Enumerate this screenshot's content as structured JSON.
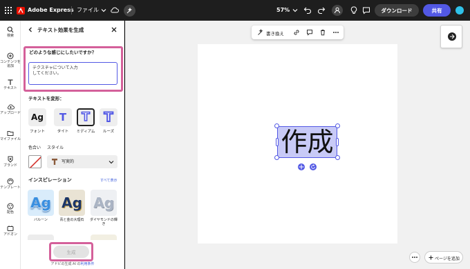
{
  "app": {
    "name": "Adobe Express",
    "file_menu": "ファイル",
    "zoom": "57%",
    "download_label": "ダウンロード",
    "share_label": "共有"
  },
  "rail": [
    {
      "label": "検索",
      "icon": "search-icon"
    },
    {
      "label": "コンテンツを追加",
      "icon": "plus-circle-icon"
    },
    {
      "label": "テキスト",
      "icon": "text-icon"
    },
    {
      "label": "アップロード",
      "icon": "upload-icon"
    },
    {
      "label": "マイファイル",
      "icon": "folder-icon"
    },
    {
      "label": "ブランド",
      "icon": "brand-icon"
    },
    {
      "label": "テンプレート",
      "icon": "template-icon"
    },
    {
      "label": "配色",
      "icon": "palette-icon"
    },
    {
      "label": "アドオン",
      "icon": "addons-icon"
    }
  ],
  "panel": {
    "title": "テキスト効果を生成",
    "prompt_question": "どのような感じにしたいですか？",
    "prompt_placeholder": "テクスチャについて入力してください。",
    "transform_label": "テキストを変形：",
    "shapes": [
      {
        "label": "フォント",
        "glyph": "Ag"
      },
      {
        "label": "タイト",
        "glyph": "T"
      },
      {
        "label": "ミディアム",
        "glyph": "T"
      },
      {
        "label": "ルーズ",
        "glyph": "T"
      }
    ],
    "color_label": "色合い",
    "style_label": "スタイル",
    "style_value": "写実的",
    "inspiration_label": "インスピレーション",
    "show_all": "すべて表示",
    "inspirations": [
      {
        "label": "バルーン",
        "glyph": "Ag",
        "color": "#3a8fe0"
      },
      {
        "label": "青と金の大理石",
        "glyph": "Ag",
        "color": "#1c3668"
      },
      {
        "label": "ダイヤモンドの輝き",
        "glyph": "Ag",
        "color": "#aab4c4"
      }
    ],
    "generate_label": "生成",
    "terms_prefix": "アドビの生成 AI の",
    "terms_link": "利用条件"
  },
  "canvas": {
    "toolbar_rewrite": "書き換え",
    "text": "作成",
    "add_page": "ページを追加"
  },
  "colors": {
    "accent": "#5258e4",
    "highlight": "#d4609a",
    "topbar": "#1e1e1e"
  }
}
